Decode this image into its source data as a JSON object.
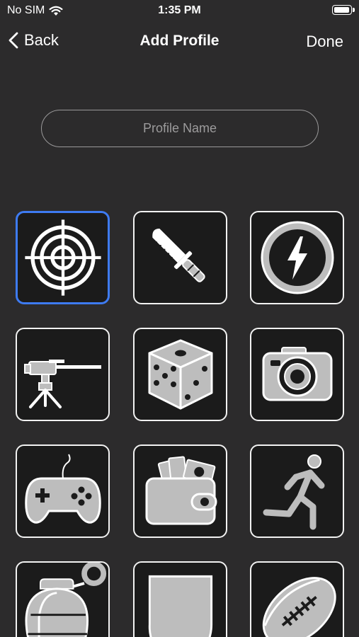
{
  "status_bar": {
    "carrier": "No SIM",
    "time": "1:35 PM",
    "battery_level": 0.95
  },
  "nav": {
    "back_label": "Back",
    "title": "Add Profile",
    "done_label": "Done"
  },
  "profile_name": {
    "placeholder": "Profile Name",
    "value": ""
  },
  "icons": [
    {
      "icon": "target-icon",
      "selected": true
    },
    {
      "icon": "knife-icon",
      "selected": false
    },
    {
      "icon": "lightning-icon",
      "selected": false
    },
    {
      "icon": "machine-gun-icon",
      "selected": false
    },
    {
      "icon": "dice-icon",
      "selected": false
    },
    {
      "icon": "camera-icon",
      "selected": false
    },
    {
      "icon": "gamepad-icon",
      "selected": false
    },
    {
      "icon": "wallet-icon",
      "selected": false
    },
    {
      "icon": "runner-icon",
      "selected": false
    },
    {
      "icon": "grenade-icon",
      "selected": false
    },
    {
      "icon": "shield-icon",
      "selected": false
    },
    {
      "icon": "football-icon",
      "selected": false
    }
  ],
  "colors": {
    "background": "#2c2b2c",
    "tile_background": "#1b1b1b",
    "tile_border": "#f2f2f2",
    "selected_border": "#3e7bf2",
    "icon_fill": "#bdbdbd"
  }
}
